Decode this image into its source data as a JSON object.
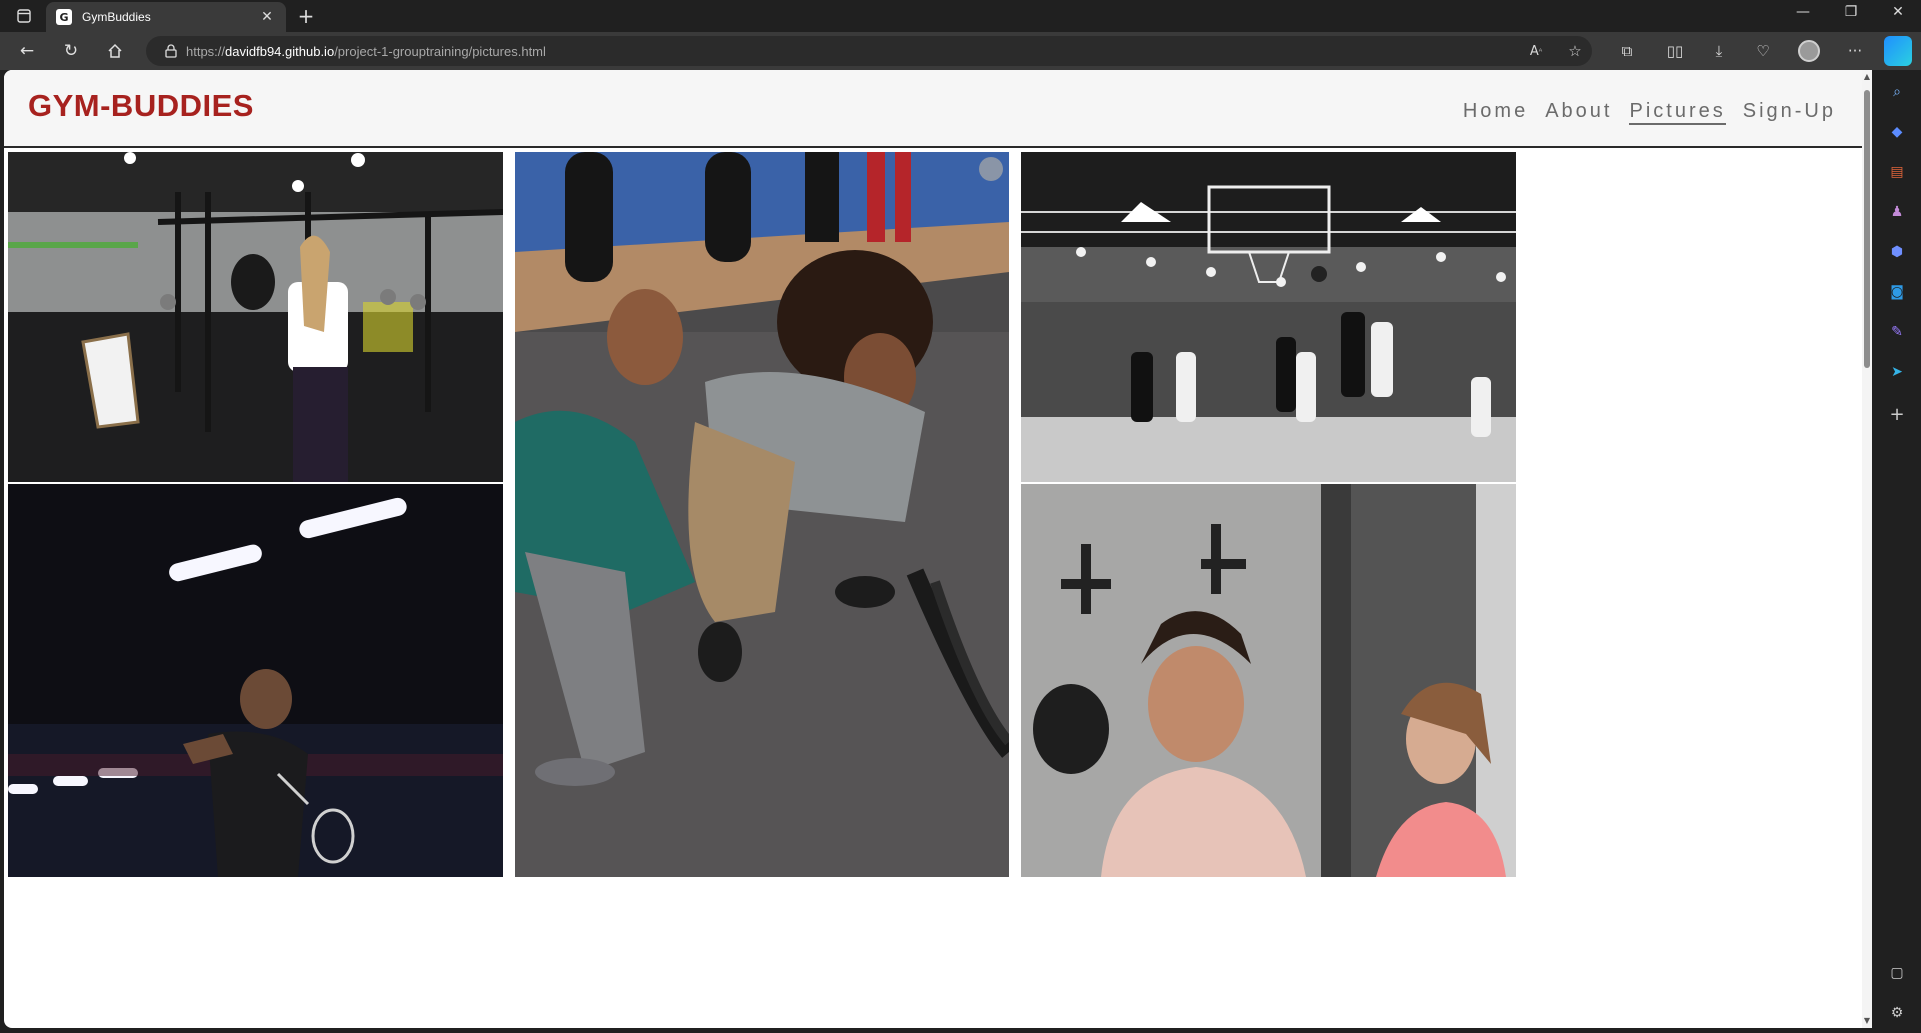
{
  "browser": {
    "tab_title": "GymBuddies",
    "favicon_letter": "G",
    "url_scheme": "https://",
    "url_host": "davidfb94.github.io",
    "url_path": "/project-1-grouptraining/pictures.html"
  },
  "site": {
    "logo": "GYM-BUDDIES",
    "nav": [
      {
        "label": "Home",
        "active": false
      },
      {
        "label": "About",
        "active": false
      },
      {
        "label": "Pictures",
        "active": true
      },
      {
        "label": "Sign-Up",
        "active": false
      }
    ]
  },
  "gallery": {
    "photos": [
      {
        "subject": "crossfit-gym-training"
      },
      {
        "subject": "trainer-battle-ropes"
      },
      {
        "subject": "basketball-game-black-and-white"
      },
      {
        "subject": "badminton-player"
      },
      {
        "subject": "women-smiling-boxing-gym"
      }
    ]
  },
  "colors": {
    "brand": "#a7221f",
    "nav_text": "#6b6b6b",
    "chrome_dark": "#202020",
    "chrome_toolbar": "#3a3a3a"
  }
}
